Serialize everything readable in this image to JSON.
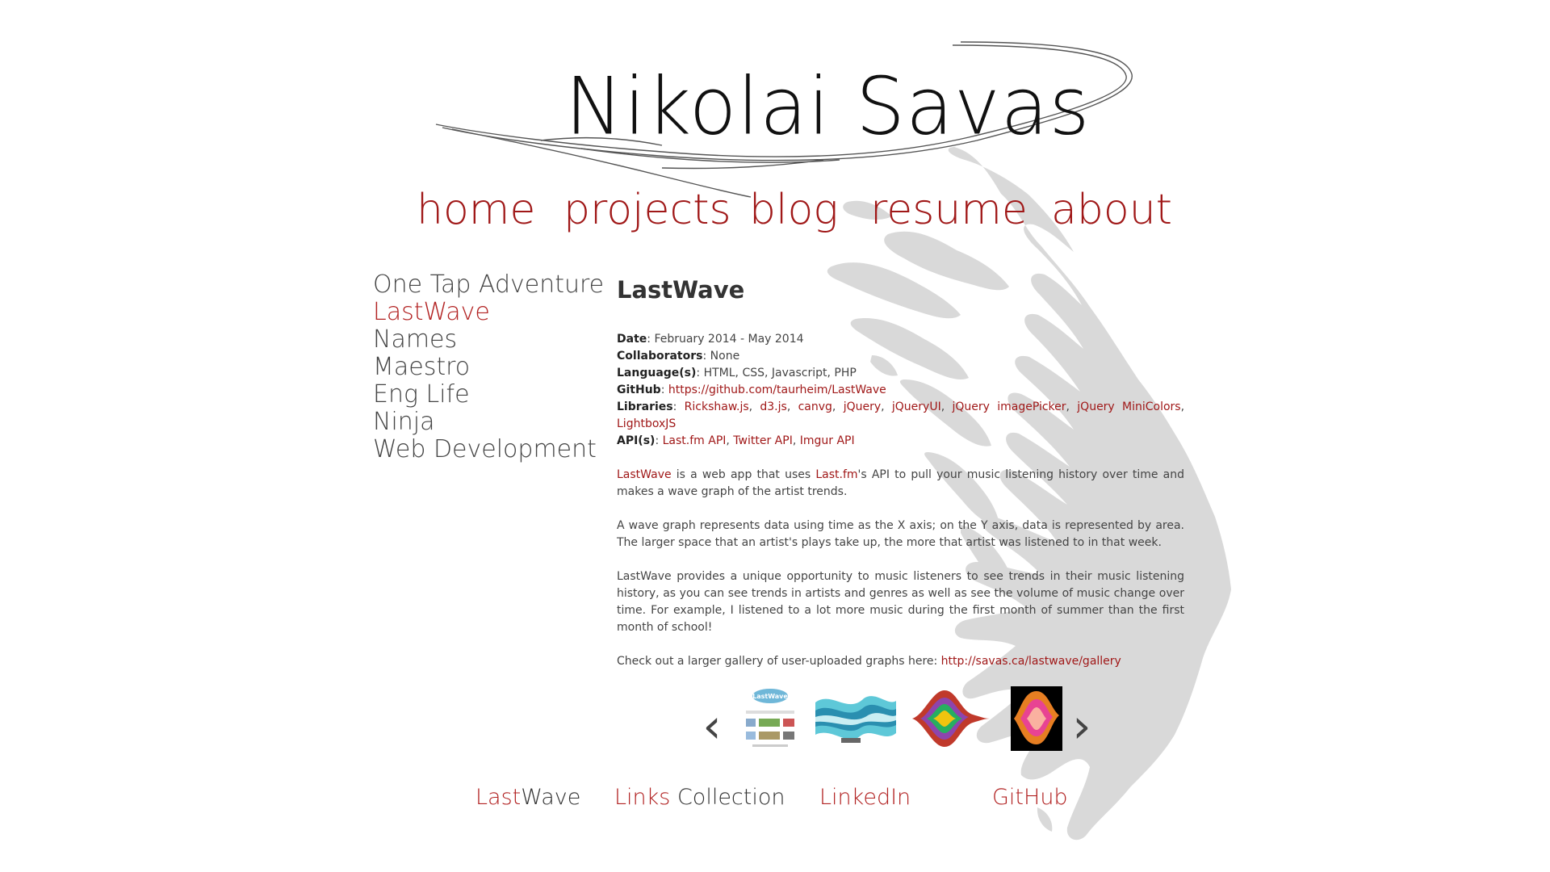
{
  "site": {
    "name": "Nikolai Savas"
  },
  "colors": {
    "accent": "#a01818",
    "text": "#444444",
    "splash": "#d9d9d9"
  },
  "main_nav": [
    {
      "label": "home"
    },
    {
      "label": "projects"
    },
    {
      "label": "blog"
    },
    {
      "label": "resume"
    },
    {
      "label": "about"
    }
  ],
  "side_nav": {
    "items": [
      {
        "label": "One Tap Adventure"
      },
      {
        "label": "LastWave",
        "active": true
      },
      {
        "label": "Names"
      },
      {
        "label": "Maestro"
      },
      {
        "label": "Eng Life"
      },
      {
        "label": "Ninja"
      },
      {
        "label": "Web Development"
      }
    ]
  },
  "project": {
    "title": "LastWave",
    "date_label": "Date",
    "date_value": "February 2014 - May 2014",
    "collab_label": "Collaborators",
    "collab_value": "None",
    "lang_label": "Language(s)",
    "lang_value": "HTML, CSS, Javascript, PHP",
    "github_label": "GitHub",
    "github_link": "https://github.com/taurheim/LastWave",
    "libraries_label": "Libraries",
    "libraries": [
      "Rickshaw.js",
      "d3.js",
      "canvg",
      "jQuery",
      "jQueryUI",
      "jQuery imagePicker",
      "jQuery MiniColors",
      "LightboxJS"
    ],
    "api_label": "API(s)",
    "apis": [
      "Last.fm API",
      "Twitter API",
      "Imgur API"
    ],
    "p1_link1": "LastWave",
    "p1_text1": " is a web app that uses ",
    "p1_link2": "Last.fm",
    "p1_text2": "'s API to pull your music listening history over time and makes a wave graph of the artist trends.",
    "p2": "A wave graph represents data using time as the X axis; on the Y axis, data is represented by area. The larger space that an artist's plays take up, the more that artist was listened to in that week.",
    "p3": "LastWave provides a unique opportunity to music listeners to see trends in their music listening history, as you can see trends in artists and genres as well as see the volume of music change over time. For example, I listened to a lot more music during the first month of summer than the first month of school!",
    "p4_text": "Check out a larger gallery of user-uploaded graphs here: ",
    "p4_link": "http://savas.ca/lastwave/gallery"
  },
  "gallery": {
    "prev_icon": "chevron-left-icon",
    "next_icon": "chevron-right-icon",
    "prev_glyph": "‹",
    "next_glyph": "›",
    "thumb_logo_text": "LastWave"
  },
  "footer_nav": [
    {
      "highlight": "Last",
      "rest": "Wave"
    },
    {
      "highlight": "Links",
      "rest": " Collection"
    },
    {
      "highlight": "LinkedIn",
      "rest": ""
    },
    {
      "highlight": "GitHub",
      "rest": ""
    }
  ]
}
